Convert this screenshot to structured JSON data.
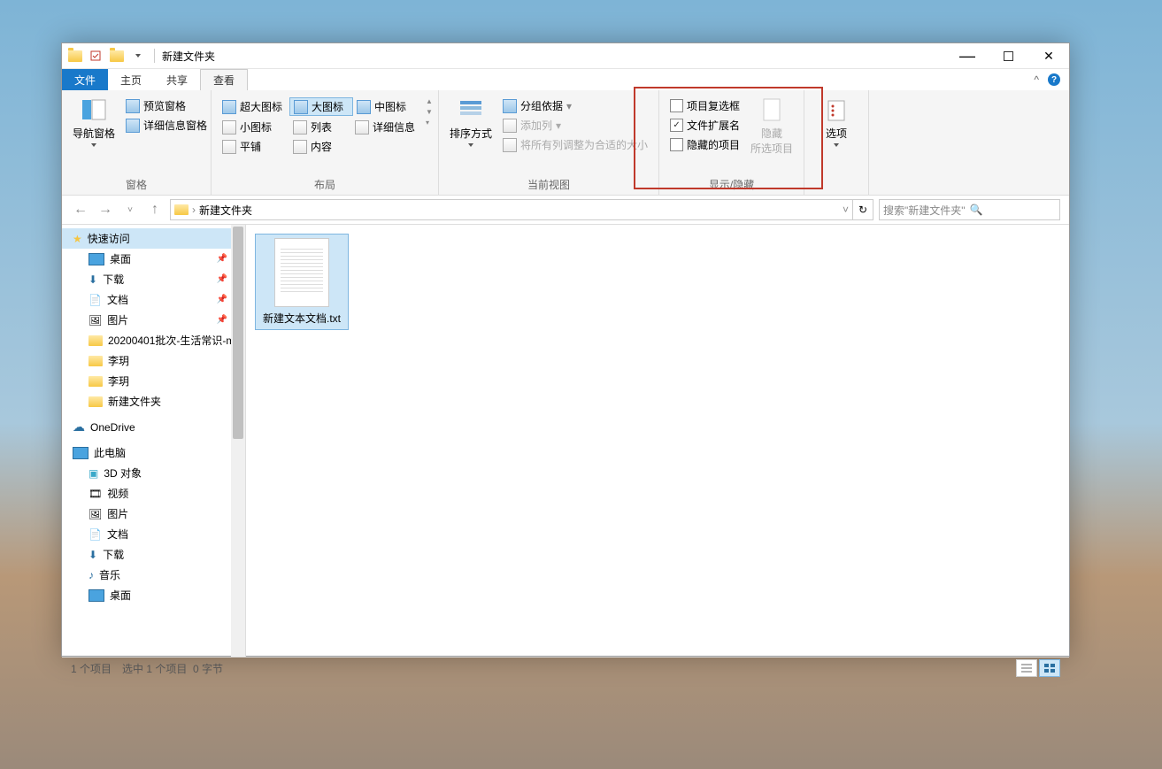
{
  "titlebar": {
    "title": "新建文件夹"
  },
  "tabs": {
    "file": "文件",
    "home": "主页",
    "share": "共享",
    "view": "查看"
  },
  "ribbon": {
    "panes": {
      "nav_pane": "导航窗格",
      "preview": "预览窗格",
      "details_pane": "详细信息窗格",
      "label": "窗格"
    },
    "layout": {
      "extra_large": "超大图标",
      "large": "大图标",
      "medium": "中图标",
      "small": "小图标",
      "list": "列表",
      "details": "详细信息",
      "tiles": "平铺",
      "content": "内容",
      "label": "布局"
    },
    "view": {
      "sort": "排序方式",
      "group_by": "分组依据",
      "add_columns": "添加列",
      "fit_columns": "将所有列调整为合适的大小",
      "label": "当前视图"
    },
    "showhide": {
      "item_checkboxes": "项目复选框",
      "file_ext": "文件扩展名",
      "hidden_items": "隐藏的项目",
      "hide": "隐藏",
      "selected_items": "所选项目",
      "options": "选项",
      "label": "显示/隐藏"
    }
  },
  "address": {
    "folder": "新建文件夹",
    "search_placeholder": "搜索\"新建文件夹\""
  },
  "sidebar": {
    "quick_access": "快速访问",
    "items": [
      {
        "label": "桌面",
        "pinned": true
      },
      {
        "label": "下载",
        "pinned": true
      },
      {
        "label": "文档",
        "pinned": true
      },
      {
        "label": "图片",
        "pinned": true
      },
      {
        "label": "20200401批次-生活常识-m",
        "pinned": false
      },
      {
        "label": "李玥",
        "pinned": false
      },
      {
        "label": "李玥",
        "pinned": false
      },
      {
        "label": "新建文件夹",
        "pinned": false
      }
    ],
    "onedrive": "OneDrive",
    "this_pc": "此电脑",
    "pc_items": [
      {
        "label": "3D 对象"
      },
      {
        "label": "视频"
      },
      {
        "label": "图片"
      },
      {
        "label": "文档"
      },
      {
        "label": "下载"
      },
      {
        "label": "音乐"
      },
      {
        "label": "桌面"
      }
    ]
  },
  "files": [
    {
      "name": "新建文本文档.txt"
    }
  ],
  "status": {
    "count": "1 个项目",
    "selected": "选中 1 个项目",
    "size": "0 字节"
  }
}
